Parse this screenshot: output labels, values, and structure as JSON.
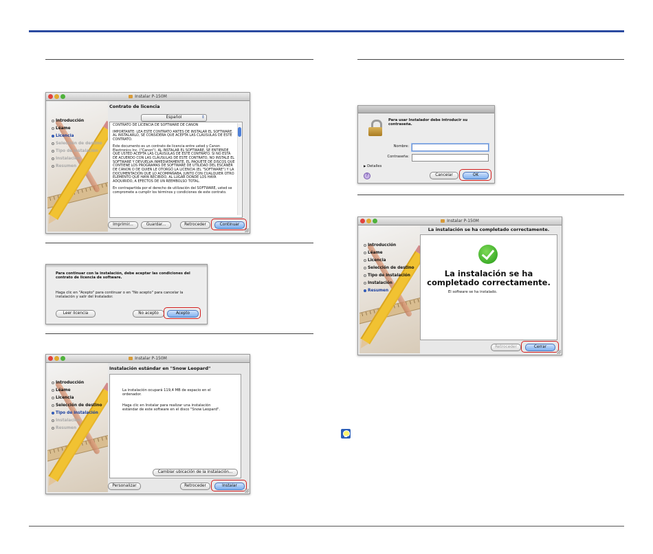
{
  "window_title": "Instalar P-150M",
  "sidebar": [
    "Introducción",
    "Léame",
    "Licencia",
    "Selección de destino",
    "Tipo de instalación",
    "Instalación",
    "Resumen"
  ],
  "license": {
    "heading": "Contrato de licencia",
    "language": "Español",
    "paragraphs": [
      "CONTRATO DE LICENCIA DE SOFTWARE DE CANON",
      "IMPORTANTE: LEA ESTE CONTRATO ANTES DE INSTALAR EL SOFTWARE. AL INSTALARLO, SE CONSIDERA QUE ACEPTA LAS CLÁUSULAS DE ESTE CONTRATO.",
      "Este documento es un contrato de licencia entre usted y Canon Electronics Inc. (\"Canon\"). AL INSTALAR EL SOFTWARE, SE ENTIENDE QUE USTED ACEPTA LAS CLÁUSULAS DE ESTE CONTRATO. SI NO ESTÁ DE ACUERDO CON LAS CLÁUSULAS DE ESTE CONTRATO, NO INSTALE EL SOFTWARE Y DEVUELVA INMEDIATAMENTE, EL PAQUETE DE DISCOS QUE CONTIENE LOS PROGRAMAS DE SOFTWARE DE UTILIDAD DEL ESCÁNER DE CANON O DE QUIEN LE OTORGÓ LA LICENCIA (EL \"SOFTWARE\") Y LA DOCUMENTACIÓN QUE LO ACOMPAÑABA, JUNTO CON CUALQUIER OTRO ELEMENTO QUE HAYA RECIBIDO, AL LUGAR DONDE LOS HAYA ADQUIRIDO, A EFECTOS DE UN REEMBOLSO TOTAL.",
      "En contrapartida por el derecho de utilización del SOFTWARE, usted se compromete a cumplir los términos y condiciones de este contrato."
    ],
    "buttons": [
      "Imprimir...",
      "Guardar...",
      "Retroceder",
      "Continuar"
    ]
  },
  "agree": {
    "line1": "Para continuar con la instalación, debe aceptar las condiciones del contrato de licencia de software.",
    "line2": "Haga clic en \"Acepto\" para continuar o en \"No acepto\" para cancelar la instalación y salir del Instalador.",
    "read": "Leer licencia",
    "no": "No acepto",
    "yes": "Acepto"
  },
  "standard": {
    "heading": "Instalación estándar en \"Snow Leopard\"",
    "p1": "La instalación ocupará 119,4 MB de espacio en el ordenador.",
    "p2": "Haga clic en Instalar para realizar una instalación estándar de este software en el disco \"Snow Leopard\".",
    "change": "Cambiar ubicación de la instalación...",
    "customize": "Personalizar",
    "back": "Retroceder",
    "install": "Instalar"
  },
  "auth": {
    "message": "Para usar Instalador debe introducir su contraseña.",
    "name_label": "Nombre:",
    "name_value": "",
    "password_label": "Contraseña:",
    "details": "Detalles",
    "cancel": "Cancelar",
    "ok": "OK"
  },
  "summary": {
    "heading": "La instalación se ha completado correctamente.",
    "big": "La instalación se ha completado correctamente.",
    "sub": "El software se ha instalado.",
    "back": "Retroceder",
    "close": "Cerrar"
  },
  "colors": {
    "accent_bar": "#2b4aa0",
    "highlight": "#d31c1c",
    "check": "#3fae2a"
  }
}
